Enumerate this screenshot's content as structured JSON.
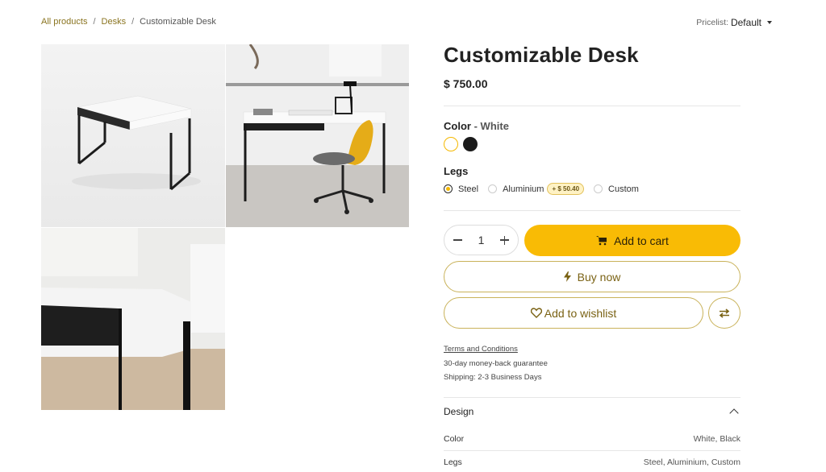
{
  "breadcrumb": {
    "all_products": "All products",
    "sep1": "/",
    "desks": "Desks",
    "sep2": "/",
    "current": "Customizable Desk"
  },
  "pricelist": {
    "label": "Pricelist:",
    "value": "Default"
  },
  "product": {
    "title": "Customizable Desk",
    "price": "$ 750.00"
  },
  "color": {
    "label": "Color",
    "dash": "-",
    "selected": "White",
    "swatches": [
      "#ffffff",
      "#1b1b1b"
    ],
    "accent": "#f5b800"
  },
  "legs": {
    "label": "Legs",
    "options": [
      {
        "label": "Steel",
        "selected": true
      },
      {
        "label": "Aluminium",
        "badge": "+ $ 50.40",
        "selected": false
      },
      {
        "label": "Custom",
        "selected": false
      }
    ]
  },
  "cart": {
    "quantity": "1",
    "add_to_cart": "Add to cart",
    "buy_now": "Buy now",
    "add_to_wishlist": "Add to wishlist",
    "cart_color": "#f9bb05"
  },
  "terms": {
    "link": "Terms and Conditions",
    "guarantee": "30-day money-back guarantee",
    "shipping": "Shipping: 2-3 Business Days"
  },
  "specs": {
    "section_title": "Design",
    "rows": [
      {
        "name": "Color",
        "value": "White, Black"
      },
      {
        "name": "Legs",
        "value": "Steel, Aluminium, Custom"
      }
    ]
  }
}
